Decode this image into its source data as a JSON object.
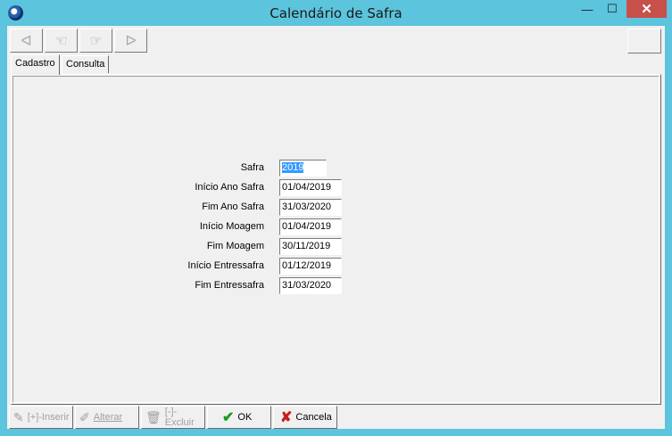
{
  "window": {
    "title": "Calendário de Safra",
    "min_glyph": "—",
    "max_glyph": "☐",
    "close_glyph": "✕"
  },
  "toolbar": {
    "first_glyph": "ᐊ",
    "prev_glyph": "☜",
    "next_glyph": "☞",
    "last_glyph": "ᐅ"
  },
  "tabs": [
    {
      "label": "Cadastro",
      "active": true
    },
    {
      "label": "Consulta",
      "active": false
    }
  ],
  "form": {
    "fields": [
      {
        "label": "Safra",
        "value": "2019"
      },
      {
        "label": "Início Ano Safra",
        "value": "01/04/2019"
      },
      {
        "label": "Fim Ano Safra",
        "value": "31/03/2020"
      },
      {
        "label": "Início Moagem",
        "value": "01/04/2019"
      },
      {
        "label": "Fim Moagem",
        "value": "30/11/2019"
      },
      {
        "label": "Início Entressafra",
        "value": "01/12/2019"
      },
      {
        "label": "Fim Entressafra",
        "value": "31/03/2020"
      }
    ]
  },
  "actions": {
    "insert": {
      "label": "[+]-Inserir",
      "icon": "✎",
      "enabled": false
    },
    "edit": {
      "label": "Alterar",
      "icon": "✐",
      "enabled": false
    },
    "delete": {
      "label": "[-]-Excluir",
      "icon": "🗑",
      "enabled": false
    },
    "ok": {
      "label": "OK",
      "icon": "✔",
      "enabled": true
    },
    "cancel": {
      "label": "Cancela",
      "icon": "✘",
      "enabled": true
    }
  },
  "colors": {
    "frame": "#5cc4dc",
    "close_button": "#c7504b",
    "selection": "#3399ff",
    "ok_green": "#1e9a1e",
    "cancel_red": "#c81e1e"
  }
}
